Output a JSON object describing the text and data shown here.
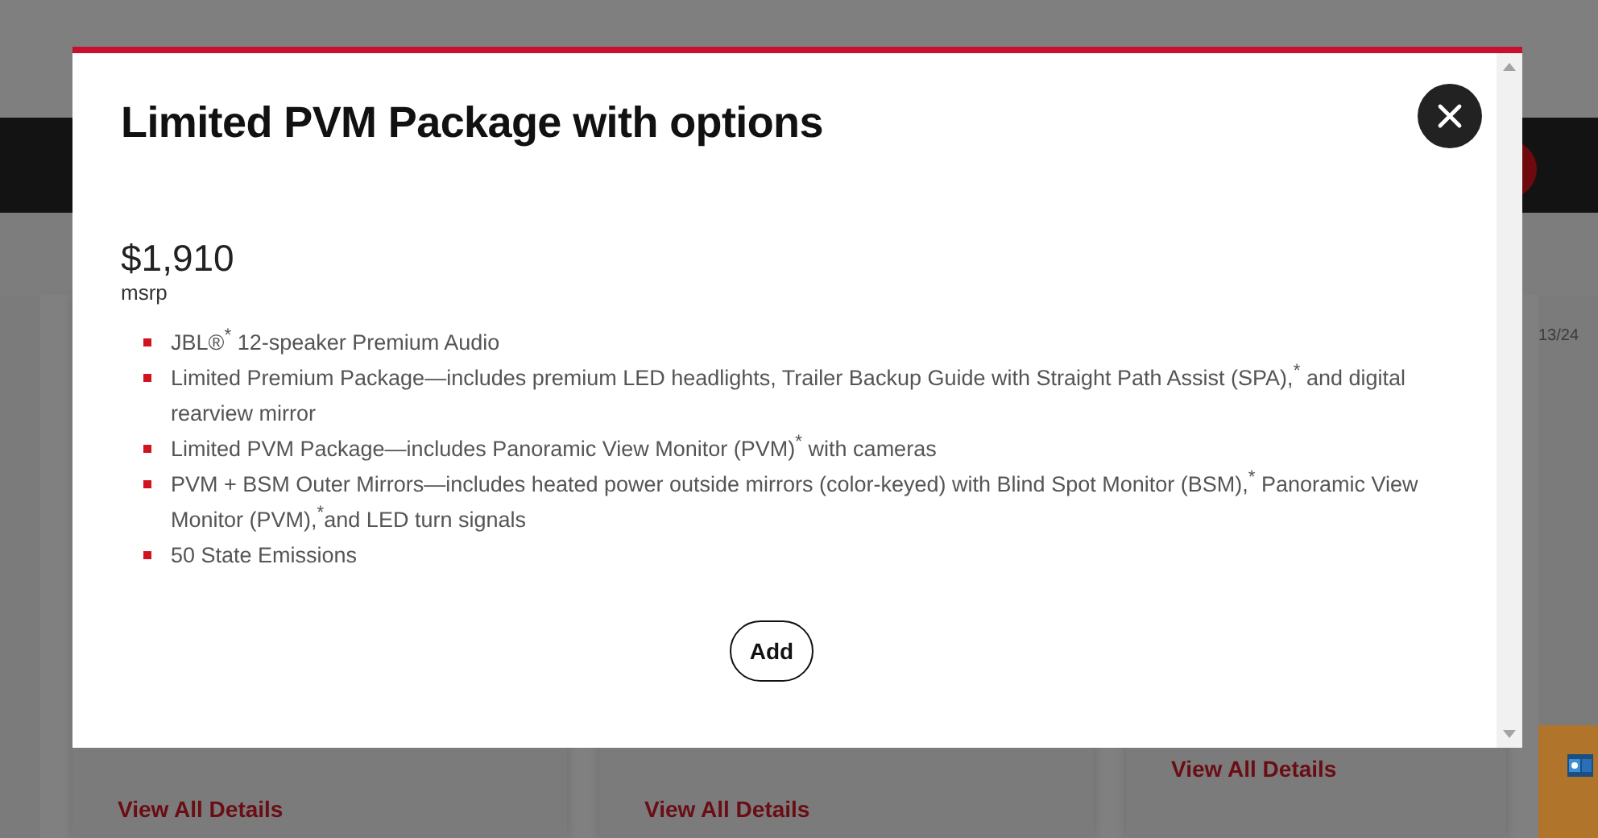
{
  "background": {
    "card_counters": [
      "13/24"
    ],
    "cards": [
      {
        "link": "View All Details"
      },
      {
        "link": "View All Details"
      },
      {
        "link": "View All Details"
      }
    ]
  },
  "modal": {
    "title": "Limited PVM Package with options",
    "price": "$1,910",
    "price_label": "msrp",
    "features": [
      "JBL®$^{*}$ 12-speaker Premium Audio",
      "Limited Premium Package—includes premium LED headlights, Trailer Backup Guide with Straight Path Assist (SPA),$^{*}$ and digital rearview mirror",
      "Limited PVM Package—includes Panoramic View Monitor (PVM)$^{*}$ with cameras",
      "PVM + BSM Outer Mirrors—includes heated power outside mirrors (color-keyed) with Blind Spot Monitor (BSM),$^{*}$ Panoramic View Monitor (PVM),$^{*}$and LED turn signals",
      "50 State Emissions"
    ],
    "button": "Add"
  }
}
